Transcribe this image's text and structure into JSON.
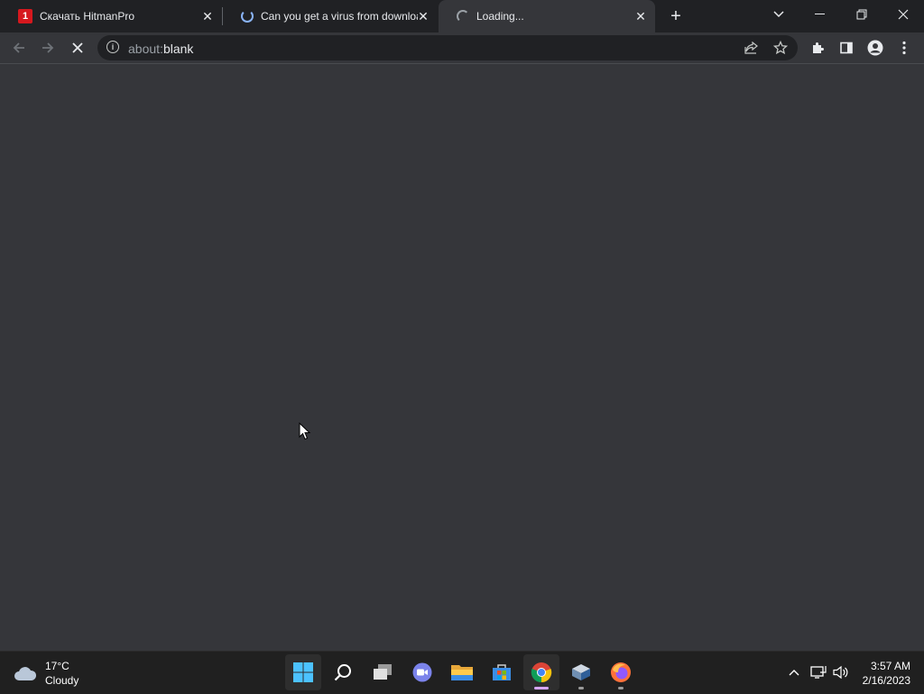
{
  "browser": {
    "tabs": [
      {
        "title": "Скачать HitmanPro",
        "favicon": "hitmanpro-logo",
        "loading": false
      },
      {
        "title": "Can you get a virus from downloa",
        "favicon": "loading-spinner",
        "loading": true
      },
      {
        "title": "Loading...",
        "favicon": "loading-spinner",
        "loading": true,
        "active": true
      }
    ],
    "address_bar": {
      "url_prefix": "about:",
      "url_main": "blank"
    }
  },
  "taskbar": {
    "weather": {
      "temp": "17°C",
      "condition": "Cloudy"
    },
    "apps": [
      "start",
      "search",
      "task-view",
      "teams-chat",
      "file-explorer",
      "microsoft-store",
      "chrome",
      "unknown-app",
      "firefox"
    ],
    "clock": {
      "time": "3:57 AM",
      "date": "2/16/2023"
    }
  },
  "colors": {
    "accent": "#8ab4f8",
    "hitman_red": "#d6181e",
    "page_bg": "#35363a",
    "tab_strip": "#202124",
    "taskbar": "#202020"
  }
}
